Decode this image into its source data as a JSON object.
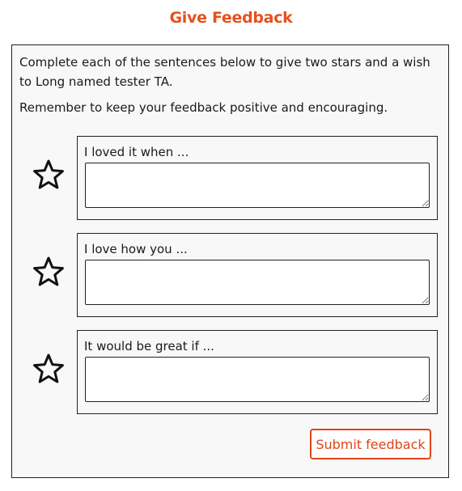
{
  "page": {
    "title": "Give Feedback"
  },
  "intro": {
    "text": "Complete each of the sentences below to give two stars and a wish to Long named tester TA.",
    "reminder": "Remember to keep your feedback positive and encouraging."
  },
  "feedback_items": [
    {
      "prompt": "I loved it when ...",
      "value": "",
      "icon": "star-outline-icon"
    },
    {
      "prompt": "I love how you ...",
      "value": "",
      "icon": "star-outline-icon"
    },
    {
      "prompt": "It would be great if ...",
      "value": "",
      "icon": "star-outline-icon"
    }
  ],
  "actions": {
    "submit_label": "Submit feedback"
  },
  "colors": {
    "accent": "#e8501c",
    "panel_background": "#f8f8f8",
    "border": "#222222"
  }
}
